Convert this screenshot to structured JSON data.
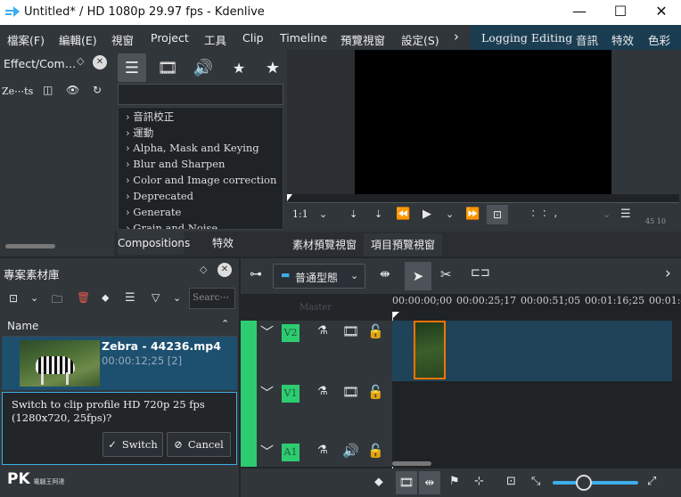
{
  "window": {
    "title": "Untitled* / HD 1080p 29.97 fps - Kdenlive",
    "minimize": "—",
    "maximize": "☐",
    "close": "✕"
  },
  "menu": {
    "items": [
      "檔案(F)",
      "編輯(E)",
      "視窗",
      "Project",
      "工具",
      "Clip",
      "Timeline",
      "預覽視窗",
      "設定(S)"
    ],
    "more": "›"
  },
  "layouts": [
    "Logging",
    "Editing",
    "音訊",
    "特效",
    "色彩"
  ],
  "effects": {
    "title": "Effect/Com…",
    "project_label": "Ze⋯ts",
    "categories": [
      "音訊校正",
      "運動",
      "Alpha, Mask and Keying",
      "Blur and Sharpen",
      "Color and Image correction",
      "Deprecated",
      "Generate",
      "Grain and Noise"
    ],
    "search_placeholder": "",
    "tabs": [
      "Compositions",
      "特效"
    ]
  },
  "monitor": {
    "zoom": "1:1",
    "tabs": [
      "素材預覽視窗",
      "項目預覽視窗"
    ],
    "ruler_nums": "45 10"
  },
  "bin": {
    "title": "專案素材庫",
    "search_placeholder": "Searc⋯",
    "column_name": "Name",
    "clip": {
      "name": "Zebra - 44236.mp4",
      "duration": "00:00:12;25 [2]"
    }
  },
  "dialog": {
    "message": "Switch to clip profile HD 720p 25 fps (1280x720, 25fps)?",
    "switch_label": "Switch",
    "cancel_label": "Cancel"
  },
  "timeline": {
    "mode": "普通型態",
    "ghost": "Master",
    "timecodes": [
      "00:00:00;00",
      "00:00:25;17",
      "00:00:51;05",
      "00:01:16;25",
      "00:01:4"
    ],
    "tracks": [
      "V2",
      "V1",
      "A1"
    ]
  },
  "watermark": {
    "brand": "PK",
    "sub": "電腦王阿達"
  },
  "colors": {
    "accent": "#3daee9",
    "track_green": "#2ecc71",
    "clip_border": "#f67400",
    "layouts_bg": "#1b3d52"
  }
}
